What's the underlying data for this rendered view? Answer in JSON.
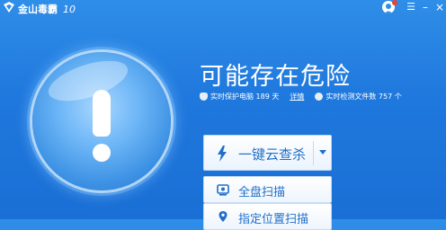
{
  "app": {
    "title": "金山毒霸",
    "version": "10"
  },
  "status": {
    "headline": "可能存在危险"
  },
  "stats": {
    "protect_text": "实时保护电脑 189 天",
    "details_link": "详情",
    "monitor_text": "实时检测文件数 757 个"
  },
  "actions": {
    "primary_scan": "一键云查杀",
    "full_scan": "全盘扫描",
    "custom_scan": "指定位置扫描"
  },
  "colors": {
    "background": "#1f78dd",
    "accent": "#1f6fc9",
    "warning_orb": "#6fb7f7"
  }
}
